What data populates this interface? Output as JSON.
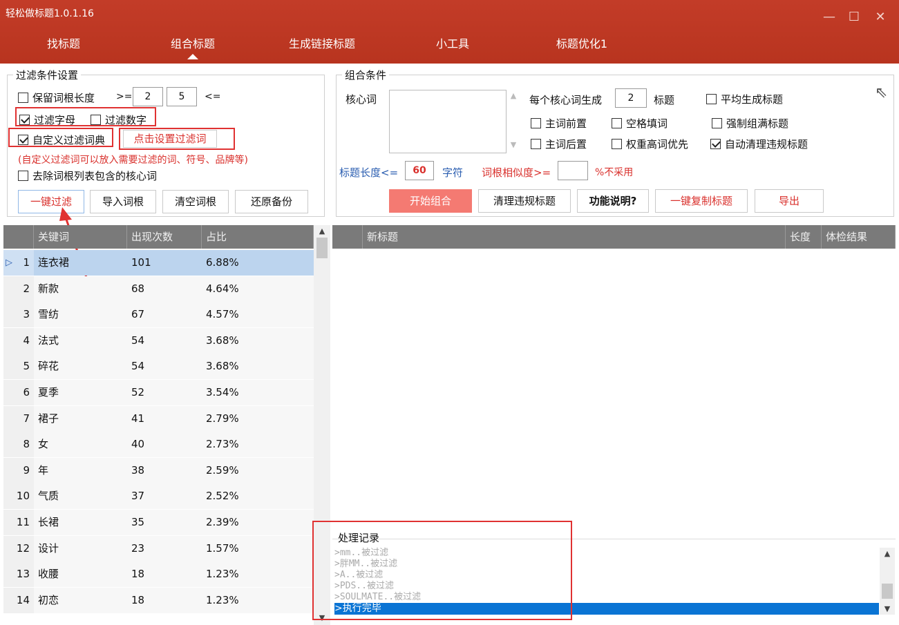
{
  "app": {
    "title": "轻松做标题1.0.1.16"
  },
  "window": {
    "minimize": "—",
    "maximize": "☐",
    "close": "✕"
  },
  "nav": {
    "tabs": [
      "找标题",
      "组合标题",
      "生成链接标题",
      "小工具",
      "标题优化1"
    ],
    "active": 1
  },
  "filter": {
    "title": "过滤条件设置",
    "keep_root_length": "保留词根长度",
    "gte": ">=",
    "min": "2",
    "max": "5",
    "lte": "<=",
    "filter_letters": "过滤字母",
    "filter_digits": "过滤数字",
    "custom_dict": "自定义过滤词典",
    "set_dict_button": "点击设置过滤词",
    "hint": "(自定义过滤词可以放入需要过滤的词、符号、品牌等)",
    "remove_core": "去除词根列表包含的核心词",
    "buttons": [
      "一键过滤",
      "导入词根",
      "清空词根",
      "还原备份"
    ]
  },
  "combine": {
    "title": "组合条件",
    "core_word": "核心词",
    "per_core": "每个核心词生成",
    "per_core_value": "2",
    "titles_unit": "标题",
    "avg": "平均生成标题",
    "main_front": "主词前置",
    "space_fill": "空格填词",
    "force_full": "强制组满标题",
    "main_back": "主词后置",
    "weight_first": "权重高词优先",
    "auto_clean": "自动清理违规标题",
    "title_len": "标题长度<=",
    "title_len_value": "60",
    "chars": "字符",
    "similarity": "词根相似度>=",
    "similarity_value": "",
    "not_used": "%不采用",
    "buttons": [
      "开始组合",
      "清理违规标题",
      "功能说明?",
      "一键复制标题",
      "导出"
    ]
  },
  "keywords": {
    "headers": [
      "关键词",
      "出现次数",
      "占比"
    ],
    "rows": [
      {
        "n": "1",
        "kw": "连衣裙",
        "cnt": "101",
        "pct": "6.88%"
      },
      {
        "n": "2",
        "kw": "新款",
        "cnt": "68",
        "pct": "4.64%"
      },
      {
        "n": "3",
        "kw": "雪纺",
        "cnt": "67",
        "pct": "4.57%"
      },
      {
        "n": "4",
        "kw": "法式",
        "cnt": "54",
        "pct": "3.68%"
      },
      {
        "n": "5",
        "kw": "碎花",
        "cnt": "54",
        "pct": "3.68%"
      },
      {
        "n": "6",
        "kw": "夏季",
        "cnt": "52",
        "pct": "3.54%"
      },
      {
        "n": "7",
        "kw": "裙子",
        "cnt": "41",
        "pct": "2.79%"
      },
      {
        "n": "8",
        "kw": "女",
        "cnt": "40",
        "pct": "2.73%"
      },
      {
        "n": "9",
        "kw": "年",
        "cnt": "38",
        "pct": "2.59%"
      },
      {
        "n": "10",
        "kw": "气质",
        "cnt": "37",
        "pct": "2.52%"
      },
      {
        "n": "11",
        "kw": "长裙",
        "cnt": "35",
        "pct": "2.39%"
      },
      {
        "n": "12",
        "kw": "设计",
        "cnt": "23",
        "pct": "1.57%"
      },
      {
        "n": "13",
        "kw": "收腰",
        "cnt": "18",
        "pct": "1.23%"
      },
      {
        "n": "14",
        "kw": "初恋",
        "cnt": "18",
        "pct": "1.23%"
      }
    ]
  },
  "results": {
    "headers": [
      "新标题",
      "长度",
      "体检结果"
    ]
  },
  "log": {
    "title": "处理记录",
    "lines": [
      ">mm..被过滤",
      ">胖MM..被过滤",
      ">A..被过滤",
      ">PDS..被过滤",
      ">SOULMATE..被过滤"
    ],
    "current": ">执行完毕"
  }
}
